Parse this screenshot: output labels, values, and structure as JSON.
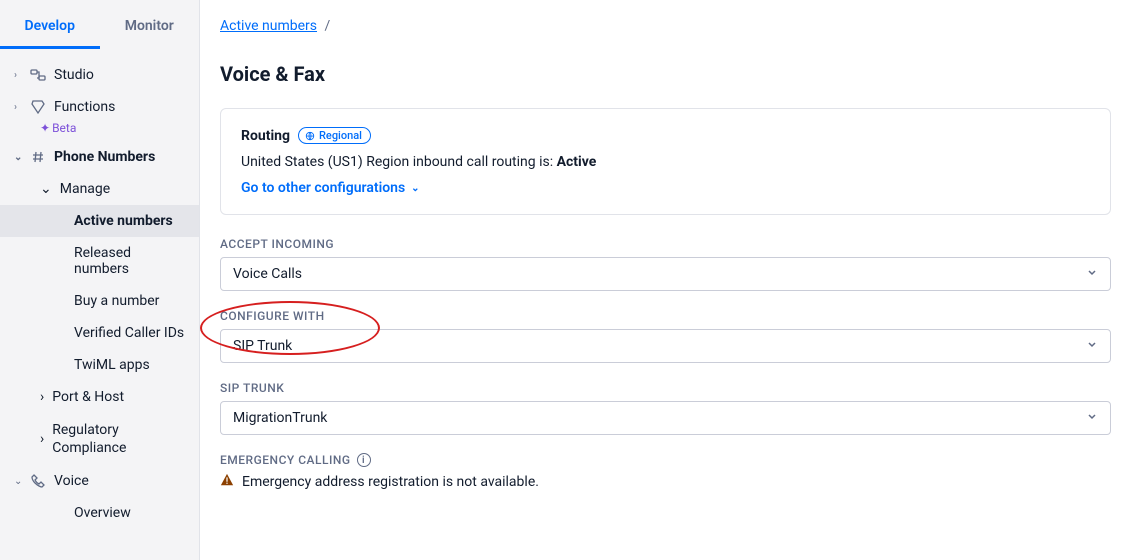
{
  "tabs": {
    "develop": "Develop",
    "monitor": "Monitor"
  },
  "sidebar": {
    "studio": "Studio",
    "functions": "Functions",
    "beta": "Beta",
    "phone_numbers": "Phone Numbers",
    "manage": "Manage",
    "active_numbers": "Active numbers",
    "released_numbers": "Released numbers",
    "buy_a_number": "Buy a number",
    "verified_caller_ids": "Verified Caller IDs",
    "twiml_apps": "TwiML apps",
    "port_host": "Port & Host",
    "regulatory_compliance": "Regulatory Compliance",
    "voice": "Voice",
    "overview": "Overview"
  },
  "breadcrumb": {
    "active_numbers": "Active numbers",
    "sep": "/"
  },
  "page_title": "Voice & Fax",
  "routing": {
    "title": "Routing",
    "pill": "Regional",
    "desc_pre": "United States (US1) Region inbound call routing is: ",
    "desc_status": "Active",
    "link": "Go to other configurations"
  },
  "fields": {
    "accept_incoming": {
      "label": "ACCEPT INCOMING",
      "value": "Voice Calls"
    },
    "configure_with": {
      "label": "CONFIGURE WITH",
      "value": "SIP Trunk"
    },
    "sip_trunk": {
      "label": "SIP TRUNK",
      "value": "MigrationTrunk"
    },
    "emergency": {
      "label": "EMERGENCY CALLING",
      "warn": "Emergency address registration is not available."
    }
  }
}
